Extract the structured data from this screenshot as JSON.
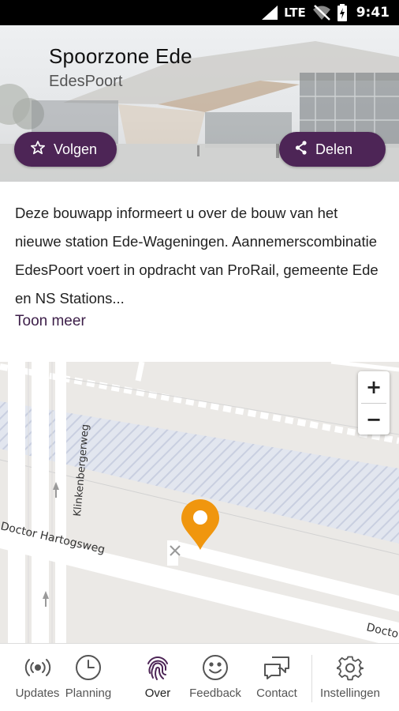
{
  "status_bar": {
    "network": "LTE",
    "time": "9:41",
    "icons": [
      "signal-icon",
      "wifi-off-icon",
      "battery-charging-icon"
    ]
  },
  "header": {
    "title": "Spoorzone Ede",
    "subtitle": "EdesPoort",
    "follow_label": "Volgen",
    "share_label": "Delen",
    "accent_color": "#4d2556"
  },
  "description": {
    "text": "Deze bouwapp informeert u over de bouw van het nieuwe station Ede-Wageningen. Aannemerscombinatie EdesPoort voert in opdracht van ProRail, gemeente Ede en NS Stations...",
    "more_label": "Toon meer"
  },
  "map": {
    "streets": [
      "Klinkenbergerweg",
      "Doctor Hartogsweg",
      "Docto"
    ],
    "zoom_in_label": "+",
    "zoom_out_label": "−",
    "marker_color": "#f0960e"
  },
  "bottom_nav": {
    "items": [
      {
        "label": "Updates",
        "icon": "broadcast-icon",
        "active": false
      },
      {
        "label": "Planning",
        "icon": "clock-icon",
        "active": false
      },
      {
        "label": "Over",
        "icon": "fingerprint-icon",
        "active": true
      },
      {
        "label": "Feedback",
        "icon": "smiley-icon",
        "active": false
      },
      {
        "label": "Contact",
        "icon": "chat-icon",
        "active": false
      },
      {
        "label": "Instellingen",
        "icon": "gear-icon",
        "active": false
      }
    ]
  }
}
